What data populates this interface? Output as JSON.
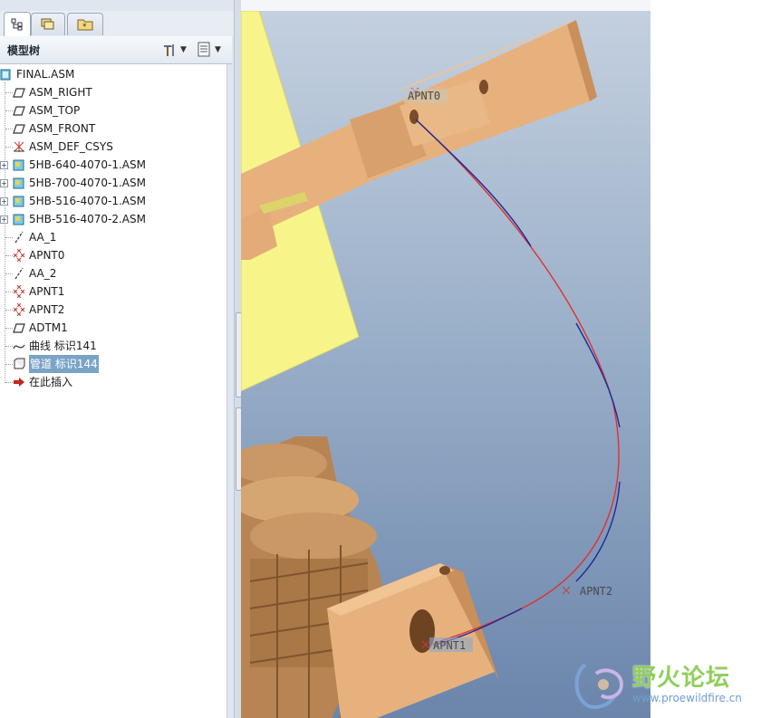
{
  "tabs": [
    {
      "name": "model-tree-tab-icon",
      "active": true
    },
    {
      "name": "layers-tab-icon",
      "active": false
    },
    {
      "name": "favorites-tab-icon",
      "active": false
    }
  ],
  "tree_header": {
    "title": "模型树"
  },
  "tree_items": [
    {
      "label": "FINAL.ASM",
      "icon": "assembly-icon",
      "expandable": false,
      "selected": false
    },
    {
      "label": "ASM_RIGHT",
      "icon": "datum-plane-icon",
      "expandable": false,
      "selected": false
    },
    {
      "label": "ASM_TOP",
      "icon": "datum-plane-icon",
      "expandable": false,
      "selected": false
    },
    {
      "label": "ASM_FRONT",
      "icon": "datum-plane-icon",
      "expandable": false,
      "selected": false
    },
    {
      "label": "ASM_DEF_CSYS",
      "icon": "csys-icon",
      "expandable": false,
      "selected": false
    },
    {
      "label": "5HB-640-4070-1.ASM",
      "icon": "subassembly-icon",
      "expandable": true,
      "selected": false
    },
    {
      "label": "5HB-700-4070-1.ASM",
      "icon": "subassembly-icon",
      "expandable": true,
      "selected": false
    },
    {
      "label": "5HB-516-4070-1.ASM",
      "icon": "subassembly-icon",
      "expandable": true,
      "selected": false
    },
    {
      "label": "5HB-516-4070-2.ASM",
      "icon": "subassembly-icon",
      "expandable": true,
      "selected": false
    },
    {
      "label": "AA_1",
      "icon": "datum-axis-icon",
      "expandable": false,
      "selected": false
    },
    {
      "label": "APNT0",
      "icon": "datum-point-icon",
      "expandable": false,
      "selected": false
    },
    {
      "label": "AA_2",
      "icon": "datum-axis-icon",
      "expandable": false,
      "selected": false
    },
    {
      "label": "APNT1",
      "icon": "datum-point-icon",
      "expandable": false,
      "selected": false
    },
    {
      "label": "APNT2",
      "icon": "datum-point-icon",
      "expandable": false,
      "selected": false
    },
    {
      "label": "ADTM1",
      "icon": "datum-plane-icon",
      "expandable": false,
      "selected": false
    },
    {
      "label": "曲线 标识141",
      "icon": "curve-icon",
      "expandable": false,
      "selected": false
    },
    {
      "label": "管道 标识144",
      "icon": "pipe-icon",
      "expandable": false,
      "selected": true
    },
    {
      "label": "在此插入",
      "icon": "insert-here-arrow-icon",
      "expandable": false,
      "selected": false
    }
  ],
  "viewport_labels": {
    "apnt0": "APNT0",
    "apnt1": "APNT1",
    "apnt2": "APNT2"
  },
  "watermark": {
    "title": "野火论坛",
    "url": "www.proewildfire.cn"
  },
  "colors": {
    "part": "#e7b17e",
    "part_shadow": "#c9905c",
    "datum_plane": "#f7f58a",
    "curve_red": "#e03030",
    "curve_blue": "#1a2a9a",
    "selection": "#7aa3c6"
  }
}
